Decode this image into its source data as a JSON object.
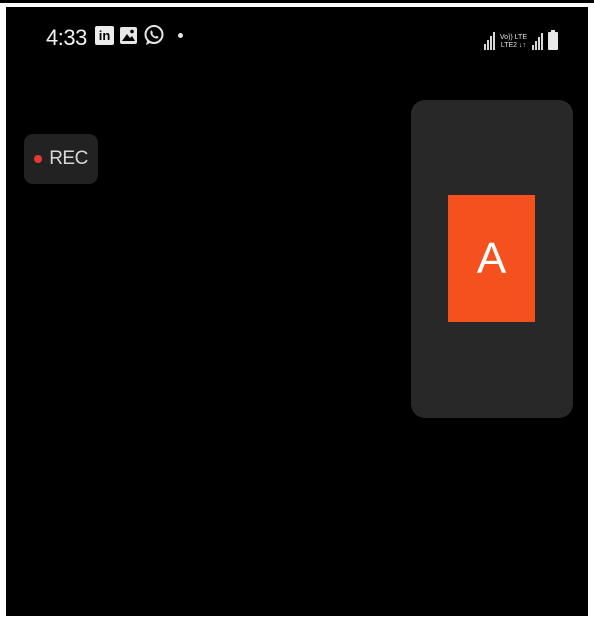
{
  "status_bar": {
    "time": "4:33",
    "linkedin_icon_text": "in",
    "lte_top": "Vo)) LTE",
    "lte_bottom": "LTE2 ↓↑",
    "icons": [
      "linkedin-icon",
      "gallery-icon",
      "whatsapp-icon",
      "notification-dot",
      "signal-icon",
      "volte-lte-icon",
      "signal-icon",
      "battery-icon"
    ]
  },
  "recording": {
    "label": "REC",
    "dot_color": "#e53935"
  },
  "self_view": {
    "avatar_letter": "A",
    "avatar_color": "#f4511e"
  }
}
